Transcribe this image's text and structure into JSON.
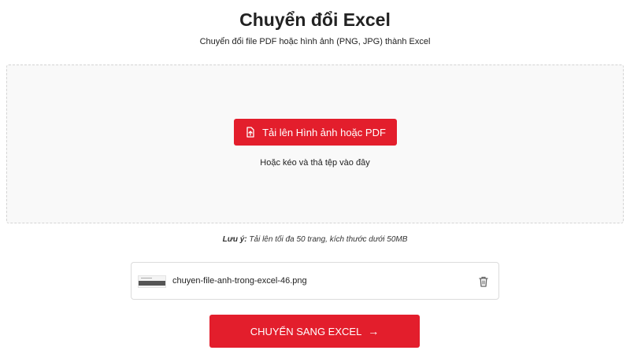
{
  "header": {
    "title": "Chuyển đổi Excel",
    "subtitle": "Chuyển đổi file PDF hoặc hình ảnh (PNG, JPG) thành Excel"
  },
  "dropzone": {
    "upload_label": "Tải lên Hình ảnh hoặc PDF",
    "upload_icon": "file-upload-icon",
    "hint": "Hoặc kéo và thả tệp vào đây"
  },
  "note": {
    "label": "Lưu ý:",
    "text": "Tải lên tối đa 50 trang, kích thước dưới 50MB"
  },
  "file": {
    "name": "chuyen-file-anh-trong-excel-46.png",
    "delete_icon": "trash-icon"
  },
  "convert": {
    "label": "CHUYỂN SANG EXCEL",
    "arrow": "→"
  },
  "colors": {
    "accent": "#e31e2c",
    "dropzone_bg": "#f9f9f9",
    "border": "#dcdcdc"
  }
}
